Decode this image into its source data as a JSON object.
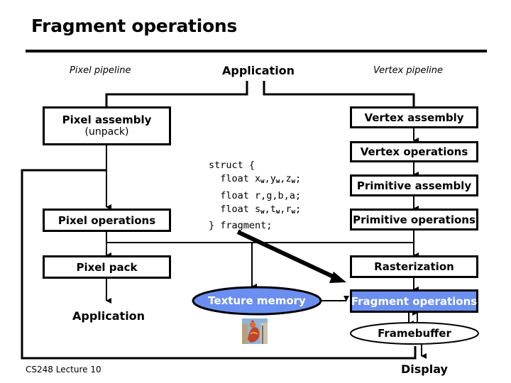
{
  "title": "Fragment operations",
  "headers": {
    "pixel_pipeline": "Pixel pipeline",
    "application_top": "Application",
    "vertex_pipeline": "Vertex pipeline"
  },
  "pixel_boxes": {
    "pixel_assembly": "Pixel assembly",
    "pixel_assembly_sub": "(unpack)",
    "pixel_operations": "Pixel operations",
    "pixel_pack": "Pixel pack",
    "application_bottom": "Application"
  },
  "vertex_boxes": {
    "vertex_assembly": "Vertex assembly",
    "vertex_operations": "Vertex operations",
    "primitive_assembly": "Primitive assembly",
    "primitive_operations": "Primitive operations",
    "rasterization": "Rasterization",
    "fragment_operations": "Fragment operations",
    "framebuffer": "Framebuffer",
    "display": "Display"
  },
  "texture_memory": "Texture memory",
  "texture_image": "rooster-texture-thumbnail",
  "code": {
    "line1": "struct {",
    "line2_prefix": "  float ",
    "line2_vars": [
      "x",
      "y",
      "z"
    ],
    "line3": "  float r,g,b,a;",
    "line4_vars": [
      "s",
      "t",
      "r"
    ],
    "subscript": "w",
    "line5": "} fragment;"
  },
  "footer": "CS248 Lecture 10",
  "colors": {
    "highlight": "#6a8ff0",
    "line": "#000000"
  }
}
